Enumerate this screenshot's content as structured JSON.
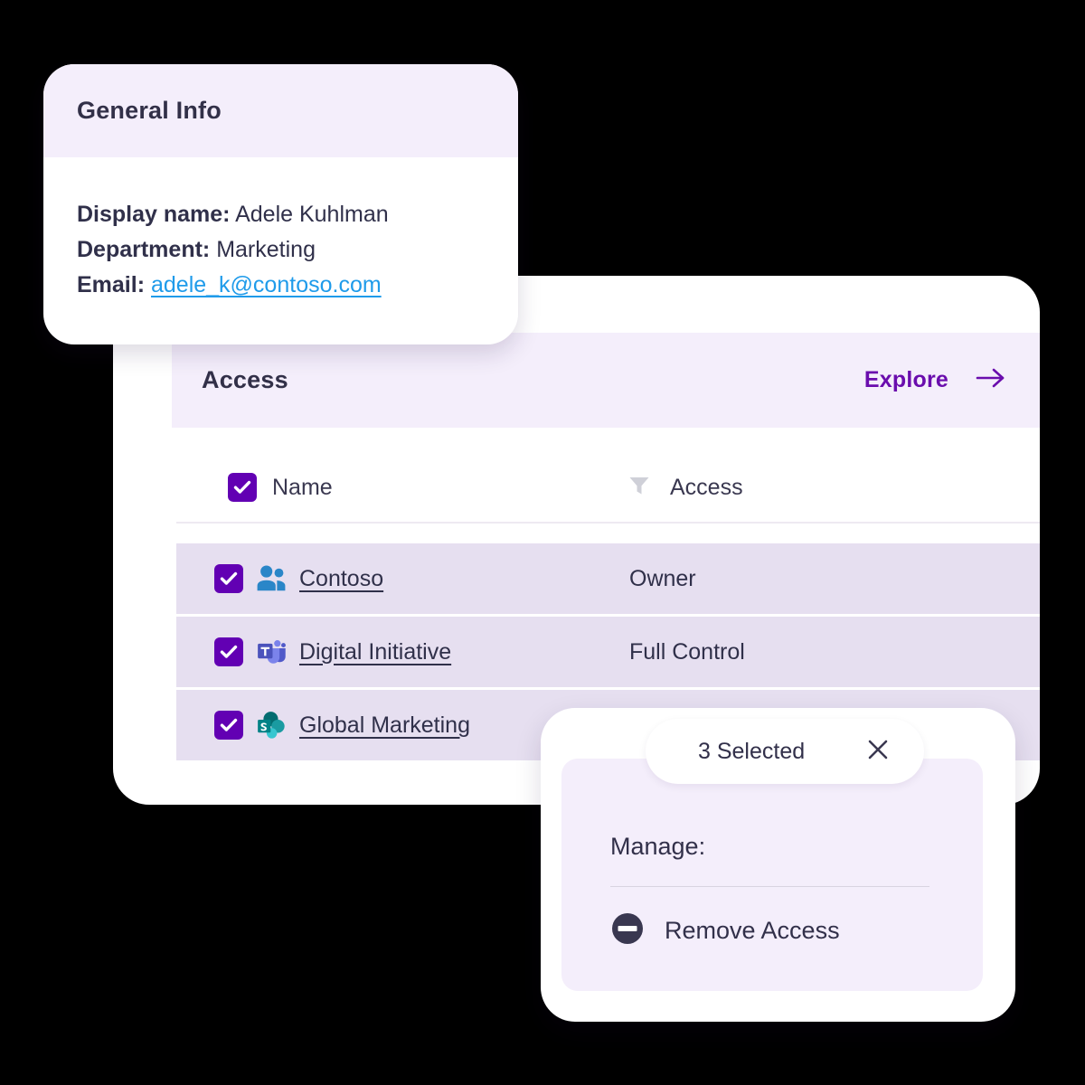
{
  "general_info": {
    "title": "General Info",
    "fields": [
      {
        "label": "Display name:",
        "value": "Adele Kuhlman"
      },
      {
        "label": "Department:",
        "value": "Marketing"
      },
      {
        "label": "Email:",
        "value": "adele_k@contoso.com"
      }
    ],
    "email_link_color": "#1f9bea"
  },
  "access_card": {
    "title": "Access",
    "explore_label": "Explore",
    "explore_arrow_icon": "arrow-right-icon",
    "accent_color": "#6a0dad",
    "header_bg": "#f4eefb",
    "table": {
      "columns": [
        {
          "label": "Name",
          "icon": "checkbox-checked-icon"
        },
        {
          "label": "Access",
          "icon": "filter-icon"
        }
      ],
      "rows": [
        {
          "checked": true,
          "icon": "people-group-icon",
          "name": "Contoso",
          "access": "Owner"
        },
        {
          "checked": true,
          "icon": "microsoft-teams-icon",
          "name": "Digital Initiative",
          "access": "Full Control"
        },
        {
          "checked": true,
          "icon": "sharepoint-icon",
          "name": "Global Marketing",
          "access": ""
        }
      ],
      "row_bg": "#e6dff0",
      "checkbox_color": "#6200b3"
    }
  },
  "manage_panel": {
    "selected_count_label": "3 Selected",
    "close_icon": "close-icon",
    "manage_label": "Manage:",
    "actions": [
      {
        "icon": "remove-access-icon",
        "label": "Remove Access"
      }
    ],
    "panel_bg": "#f4eefb"
  }
}
